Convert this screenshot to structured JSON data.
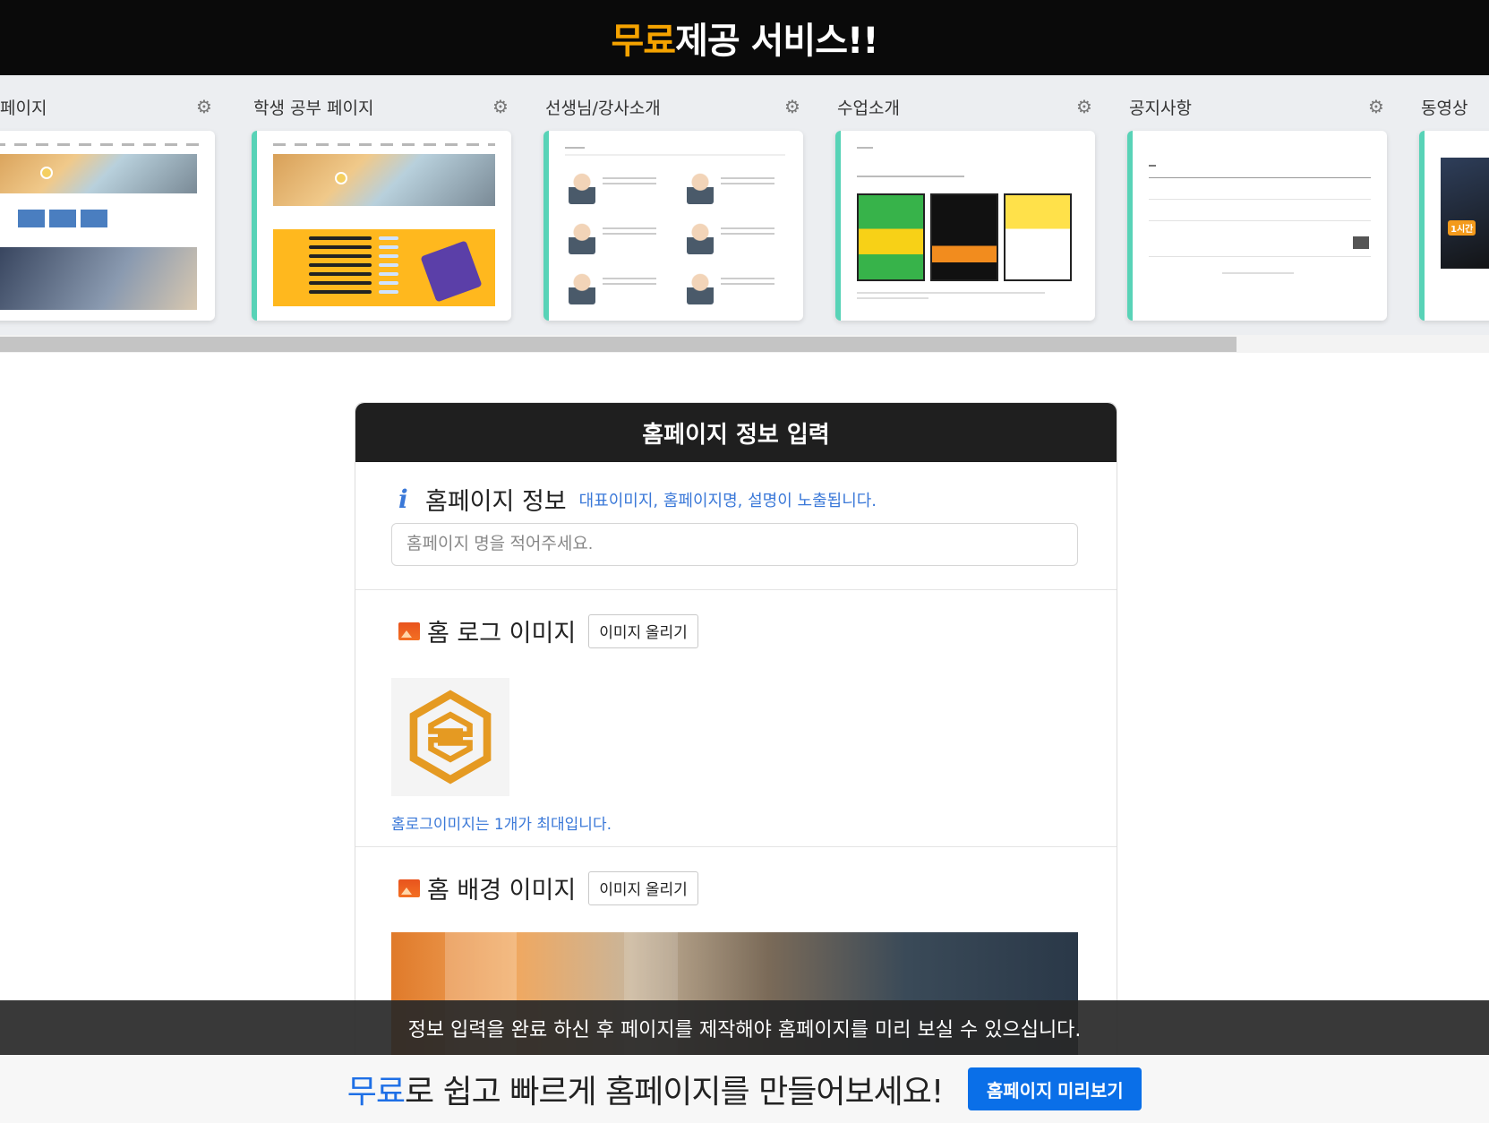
{
  "banner": {
    "title_accent": "무료",
    "title_rest": "제공 서비스!!",
    "accent_color": "#f5a300"
  },
  "templates": {
    "cards": [
      {
        "label": "페이지",
        "icon": "gear-icon"
      },
      {
        "label": "학생 공부 페이지",
        "icon": "gear-icon"
      },
      {
        "label": "선생님/강사소개",
        "icon": "gear-icon"
      },
      {
        "label": "수업소개",
        "icon": "gear-icon"
      },
      {
        "label": "공지사항",
        "icon": "gear-icon"
      },
      {
        "label": "동영상",
        "icon": "gear-icon"
      }
    ],
    "accent_color": "#58d3b7",
    "video_tag": "1시간"
  },
  "form": {
    "header": "홈페이지 정보 입력",
    "info": {
      "label": "홈페이지 정보",
      "help": "대표이미지, 홈페이지명, 설명이 노출됩니다.",
      "name_placeholder": "홈페이지 명을 적어주세요.",
      "icon": "info-icon"
    },
    "logo": {
      "label": "홈 로그 이미지",
      "upload_label": "이미지 올리기",
      "note": "홈로그이미지는 1개가 최대입니다.",
      "icon": "image-icon"
    },
    "background": {
      "label": "홈 배경 이미지",
      "upload_label": "이미지 올리기",
      "icon": "image-icon"
    }
  },
  "toast": {
    "message": "정보 입력을 완료 하신 후 페이지를 제작해야 홈페이지를 미리 보실 수 있으십니다."
  },
  "cta": {
    "accent": "무료",
    "text": "로 쉽고 빠르게 홈페이지를 만들어보세요!",
    "button_label": "홈페이지 미리보기",
    "accent_color": "#1e6fe6"
  }
}
